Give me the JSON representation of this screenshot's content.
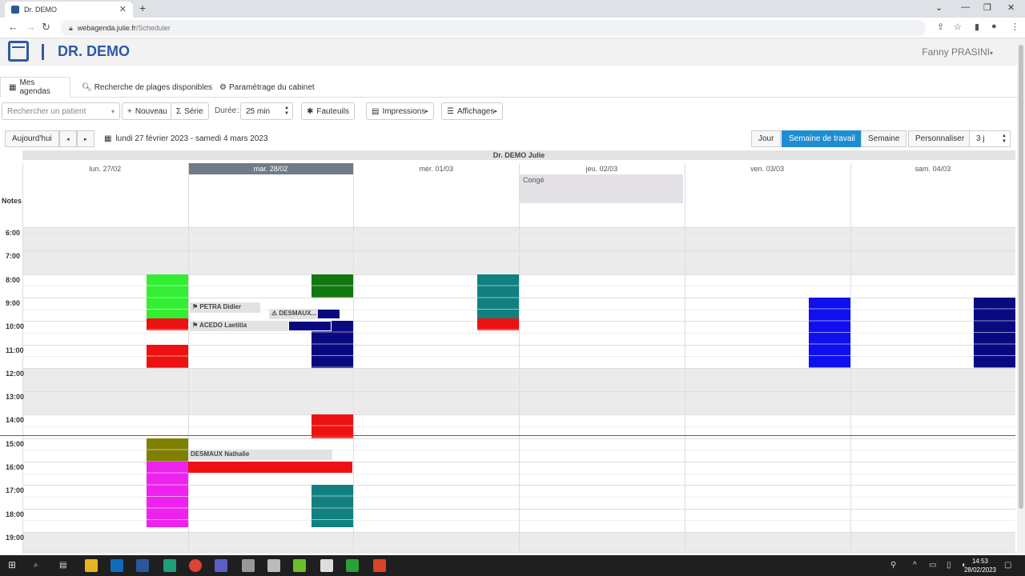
{
  "browser": {
    "tab_title": "Dr. DEMO",
    "url_host": "webagenda.julie.fr",
    "url_path": "/Scheduler"
  },
  "app": {
    "title": "DR. DEMO",
    "user": "Fanny PRASINI"
  },
  "nav": {
    "tabs": [
      "Mes agendas",
      "Recherche de plages disponibles",
      "Paramétrage du cabinet"
    ]
  },
  "toolbar": {
    "search_placeholder": "Rechercher un patient",
    "new_label": "Nouveau",
    "series_label": "Série",
    "duration_label": "Durée",
    "duration_value": "25 min",
    "chairs_label": "Fauteuils",
    "print_label": "Impressions",
    "display_label": "Affichages"
  },
  "datebar": {
    "today_label": "Aujourd'hui",
    "range": "lundi 27 février 2023 - samedi 4 mars 2023",
    "views": [
      "Jour",
      "Semaine de travail",
      "Semaine",
      "Personnaliser"
    ],
    "active_view": "Semaine de travail",
    "custom_value": "3 j"
  },
  "calendar": {
    "resource": "Dr. DEMO Julie",
    "notes_label": "Notes",
    "days": [
      "lun. 27/02",
      "mar. 28/02",
      "mer. 01/03",
      "jeu. 02/03",
      "ven. 03/03",
      "sam. 04/03"
    ],
    "today_index": 1,
    "hours": [
      "6:00",
      "7:00",
      "8:00",
      "9:00",
      "10:00",
      "11:00",
      "12:00",
      "13:00",
      "14:00",
      "15:00",
      "16:00",
      "17:00",
      "18:00",
      "19:00"
    ],
    "conge_label": "Congé",
    "events": [
      {
        "day": 0,
        "start": 8.0,
        "end": 9.9,
        "color": "#33ee33"
      },
      {
        "day": 0,
        "start": 9.9,
        "end": 10.4,
        "color": "#ee1111"
      },
      {
        "day": 0,
        "start": 11.0,
        "end": 12.0,
        "color": "#ee1111"
      },
      {
        "day": 0,
        "start": 15.0,
        "end": 16.0,
        "color": "#808000"
      },
      {
        "day": 0,
        "start": 16.0,
        "end": 18.8,
        "color": "#ee22ee"
      },
      {
        "day": 1,
        "start": 8.0,
        "end": 9.0,
        "color": "#117711"
      },
      {
        "day": 1,
        "start": 10.0,
        "end": 12.0,
        "color": "#0a0a80"
      },
      {
        "day": 1,
        "start": 14.0,
        "end": 15.0,
        "color": "#ee1111"
      },
      {
        "day": 1,
        "start": 17.0,
        "end": 18.8,
        "color": "#118080"
      },
      {
        "day": 2,
        "start": 8.0,
        "end": 9.9,
        "color": "#118080"
      },
      {
        "day": 2,
        "start": 9.9,
        "end": 10.4,
        "color": "#ee1111"
      },
      {
        "day": 4,
        "start": 9.0,
        "end": 12.0,
        "color": "#1010ee"
      },
      {
        "day": 5,
        "start": 9.0,
        "end": 12.0,
        "color": "#0a0a80"
      }
    ],
    "labels": [
      {
        "text": "PETRA Didier",
        "name": "appt-petra-didier"
      },
      {
        "text": "DESMAUX...",
        "name": "appt-desmaux-short"
      },
      {
        "text": "ACEDO Laetitia",
        "name": "appt-acedo-laetitia"
      },
      {
        "text": "DESMAUX Nathalie",
        "name": "appt-desmaux-nathalie"
      }
    ]
  },
  "taskbar": {
    "time": "14:53",
    "date": "28/02/2023"
  }
}
